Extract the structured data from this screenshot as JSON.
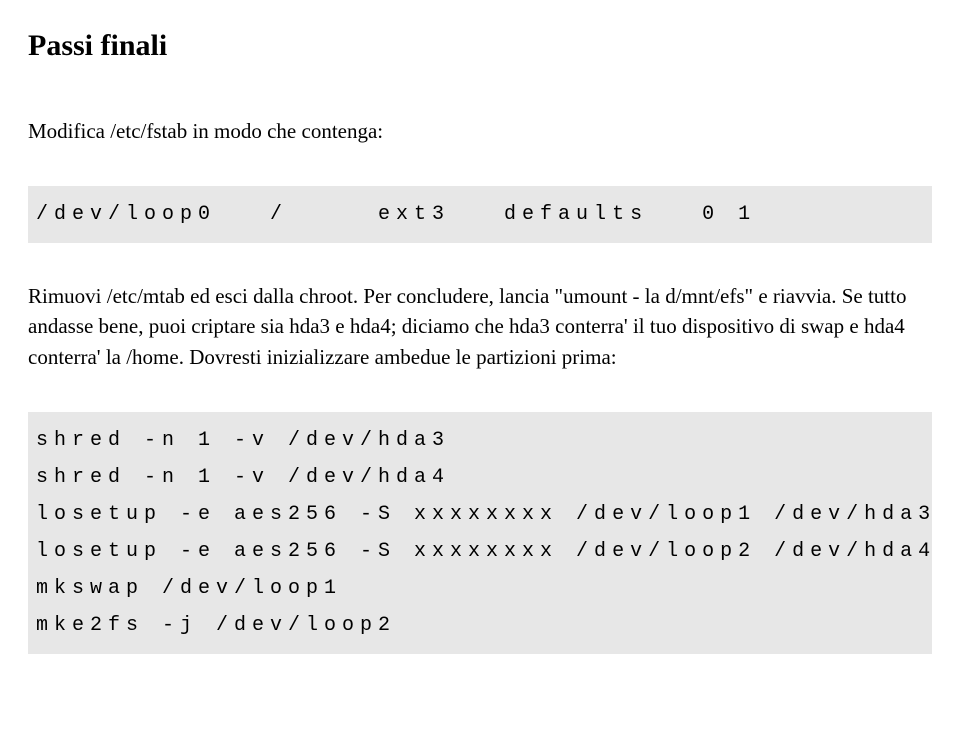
{
  "title": "Passi finali",
  "paragraph1": "Modifica /etc/fstab in modo che contenga:",
  "codeblock1": "/dev/loop0   /     ext3   defaults   0 1",
  "paragraph2": "Rimuovi /etc/mtab ed esci dalla chroot. Per concludere, lancia \"umount - la d/mnt/efs\" e riavvia. Se tutto andasse bene, puoi criptare sia hda3 e hda4; diciamo che hda3 conterra' il tuo dispositivo di swap e hda4 conterra' la /home. Dovresti inizializzare ambedue le partizioni prima:",
  "codeblock2": "shred -n 1 -v /dev/hda3\nshred -n 1 -v /dev/hda4\nlosetup -e aes256 -S xxxxxxxx /dev/loop1 /dev/hda3\nlosetup -e aes256 -S xxxxxxxx /dev/loop2 /dev/hda4\nmkswap /dev/loop1\nmke2fs -j /dev/loop2"
}
